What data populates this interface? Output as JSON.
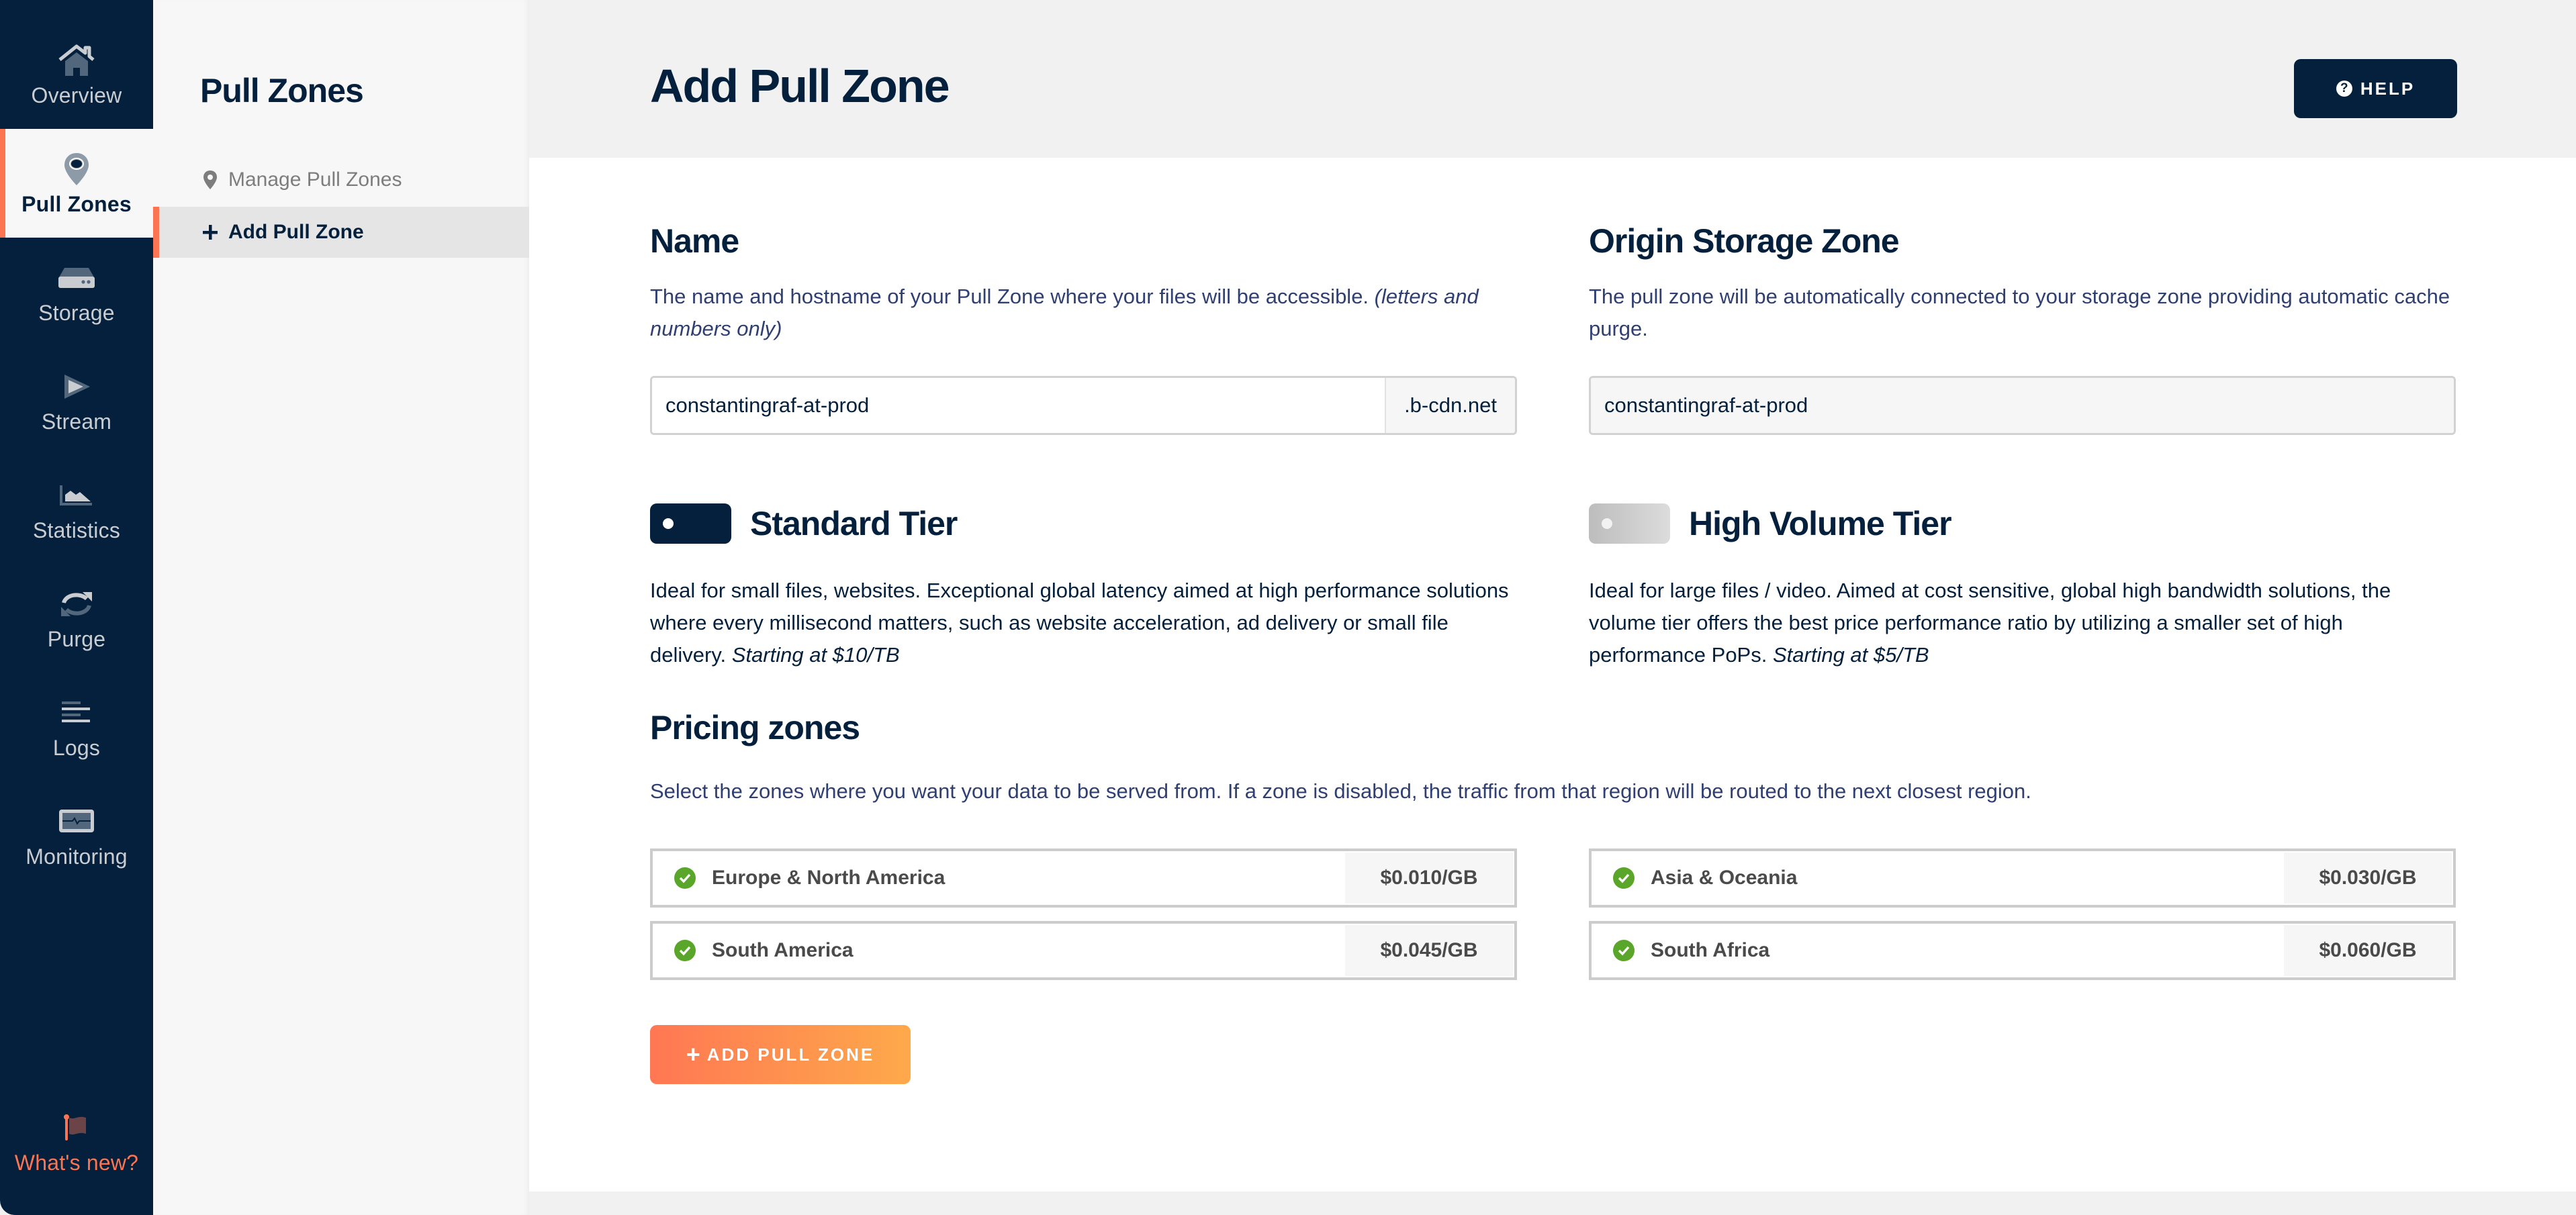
{
  "nav": {
    "items": [
      {
        "label": "Overview",
        "icon": "home-icon",
        "active": false
      },
      {
        "label": "Pull Zones",
        "icon": "map-pin-icon",
        "active": true
      },
      {
        "label": "Storage",
        "icon": "hard-drive-icon",
        "active": false
      },
      {
        "label": "Stream",
        "icon": "play-icon",
        "active": false
      },
      {
        "label": "Statistics",
        "icon": "area-chart-icon",
        "active": false
      },
      {
        "label": "Purge",
        "icon": "refresh-icon",
        "active": false
      },
      {
        "label": "Logs",
        "icon": "align-left-icon",
        "active": false
      },
      {
        "label": "Monitoring",
        "icon": "monitor-heartbeat-icon",
        "active": false
      }
    ],
    "whats_new": {
      "label": "What's new?",
      "icon": "flag-icon"
    }
  },
  "subnav": {
    "title": "Pull Zones",
    "items": [
      {
        "label": "Manage Pull Zones",
        "icon": "map-pin-icon",
        "active": false
      },
      {
        "label": "Add Pull Zone",
        "icon": "plus-icon",
        "active": true
      }
    ]
  },
  "header": {
    "title": "Add Pull Zone",
    "help_label": "HELP",
    "help_icon": "question-circle-icon"
  },
  "name_section": {
    "title": "Name",
    "description": "The name and hostname of your Pull Zone where your files will be accessible.",
    "description_note": "(letters and numbers only)",
    "value": "constantingraf-at-prod",
    "suffix": ".b-cdn.net"
  },
  "origin_section": {
    "title": "Origin Storage Zone",
    "description": "The pull zone will be automatically connected to your storage zone providing automatic cache purge.",
    "value": "constantingraf-at-prod"
  },
  "tiers": [
    {
      "title": "Standard Tier",
      "enabled": true,
      "description": "Ideal for small files, websites. Exceptional global latency aimed at high performance solutions where every millisecond matters, such as website acceleration, ad delivery or small file delivery.",
      "price_note": "Starting at $10/TB"
    },
    {
      "title": "High Volume Tier",
      "enabled": false,
      "description": "Ideal for large files / video. Aimed at cost sensitive, global high bandwidth solutions, the volume tier offers the best price performance ratio by utilizing a smaller set of high performance PoPs.",
      "price_note": "Starting at $5/TB"
    }
  ],
  "pricing": {
    "title": "Pricing zones",
    "description": "Select the zones where you want your data to be served from. If a zone is disabled, the traffic from that region will be routed to the next closest region.",
    "zones": [
      {
        "name": "Europe & North America",
        "price": "$0.010/GB",
        "enabled": true
      },
      {
        "name": "Asia & Oceania",
        "price": "$0.030/GB",
        "enabled": true
      },
      {
        "name": "South America",
        "price": "$0.045/GB",
        "enabled": true
      },
      {
        "name": "South Africa",
        "price": "$0.060/GB",
        "enabled": true
      }
    ]
  },
  "actions": {
    "add_label": "ADD PULL ZONE"
  },
  "colors": {
    "navy": "#04203c",
    "accent": "#fb7552",
    "success": "#5aa62a",
    "button_gradient_start": "#ff7753",
    "button_gradient_end": "#fea94b"
  }
}
